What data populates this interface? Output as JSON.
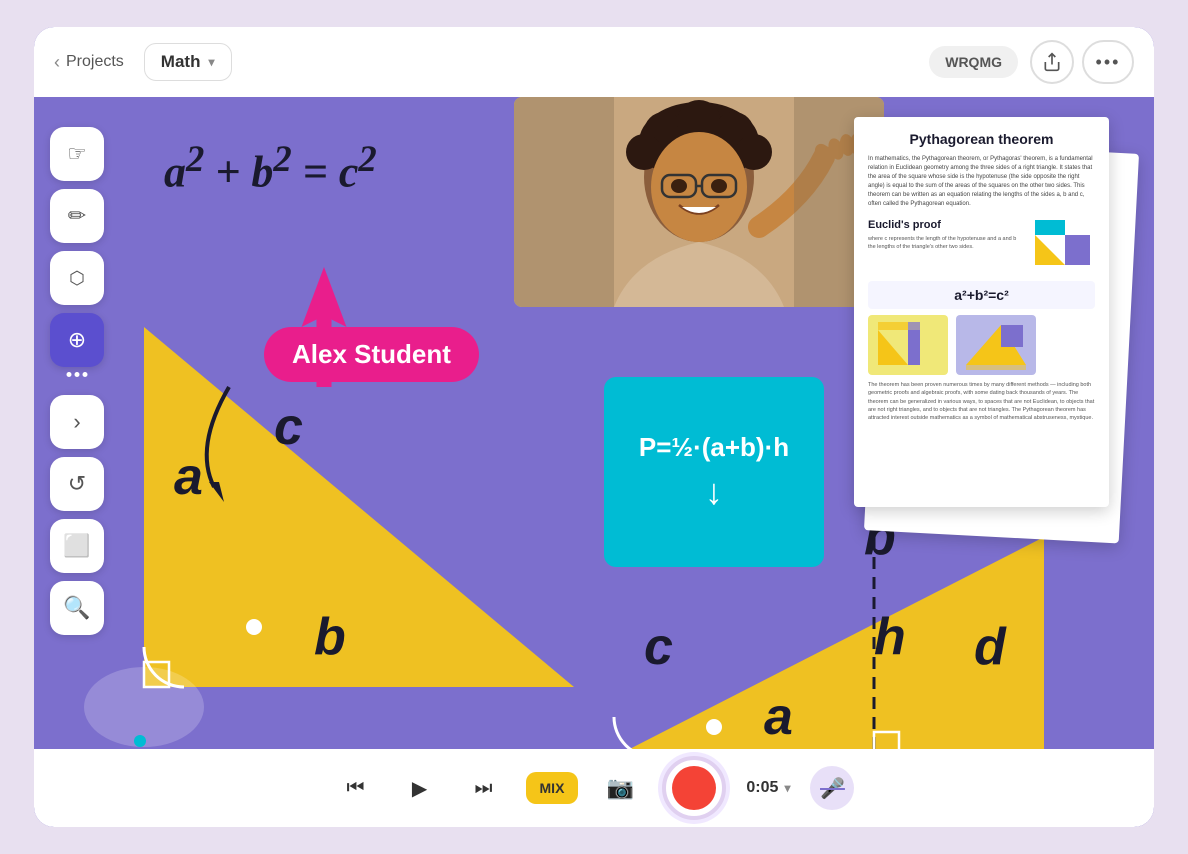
{
  "topbar": {
    "back_label": "Projects",
    "project_name": "Math",
    "session_code": "WRQMG",
    "more_dots": "•••"
  },
  "toolbar": {
    "tools": [
      {
        "name": "pointer",
        "icon": "☞",
        "active": false
      },
      {
        "name": "pencil",
        "icon": "✏",
        "active": false
      },
      {
        "name": "eraser",
        "icon": "◻",
        "active": false
      },
      {
        "name": "target",
        "icon": "⊕",
        "active": true
      },
      {
        "name": "chevron-right",
        "icon": "›",
        "active": false
      },
      {
        "name": "undo",
        "icon": "↺",
        "active": false
      },
      {
        "name": "rectangle",
        "icon": "⬜",
        "active": false
      },
      {
        "name": "zoom-in",
        "icon": "⊕",
        "active": false
      }
    ]
  },
  "canvas": {
    "math_formula": "a² + b² = c²",
    "name_tag": "Alex Student",
    "triangle_labels": {
      "a": "a",
      "b": "b",
      "c": "c"
    },
    "right_labels": {
      "b": "b",
      "c": "c",
      "h": "h",
      "d": "d",
      "a": "a"
    },
    "formula_box": {
      "formula": "P=½·(a+b)·h",
      "arrow": "↓"
    }
  },
  "document": {
    "title": "Pythagorean theorem",
    "section_title": "Euclid's proof",
    "formula_display": "a²+b²=c²",
    "body_text": "In mathematics, the Pythagorean theorem, or Pythagoras' theorem, is a fundamental relation in Euclidean geometry among the three sides of a right triangle. It states that the area of the square whose side is the hypotenuse (the side opposite the right angle) is equal to the sum of the areas of the squares on the other two sides. This theorem can be written as an equation relating the lengths of the sides a, b and c, often called the Pythagorean equation.",
    "body_text2": "The theorem has been proven numerous times by many different methods — including both geometric proofs and algebraic proofs, with some dating back thousands of years. The theorem can be generalized in various ways, to spaces that are not Euclidean, to objects that are not right triangles, and to objects that are not triangles. The Pythagorean theorem has attracted interest outside mathematics as a symbol of mathematical abstruseness, mystique."
  },
  "bottom_bar": {
    "rewind_icon": "⏮",
    "play_icon": "▶",
    "forward_icon": "⏭",
    "mix_label": "MIX",
    "camera_icon": "📷",
    "time": "0:05",
    "mute_icon": "🎤"
  }
}
